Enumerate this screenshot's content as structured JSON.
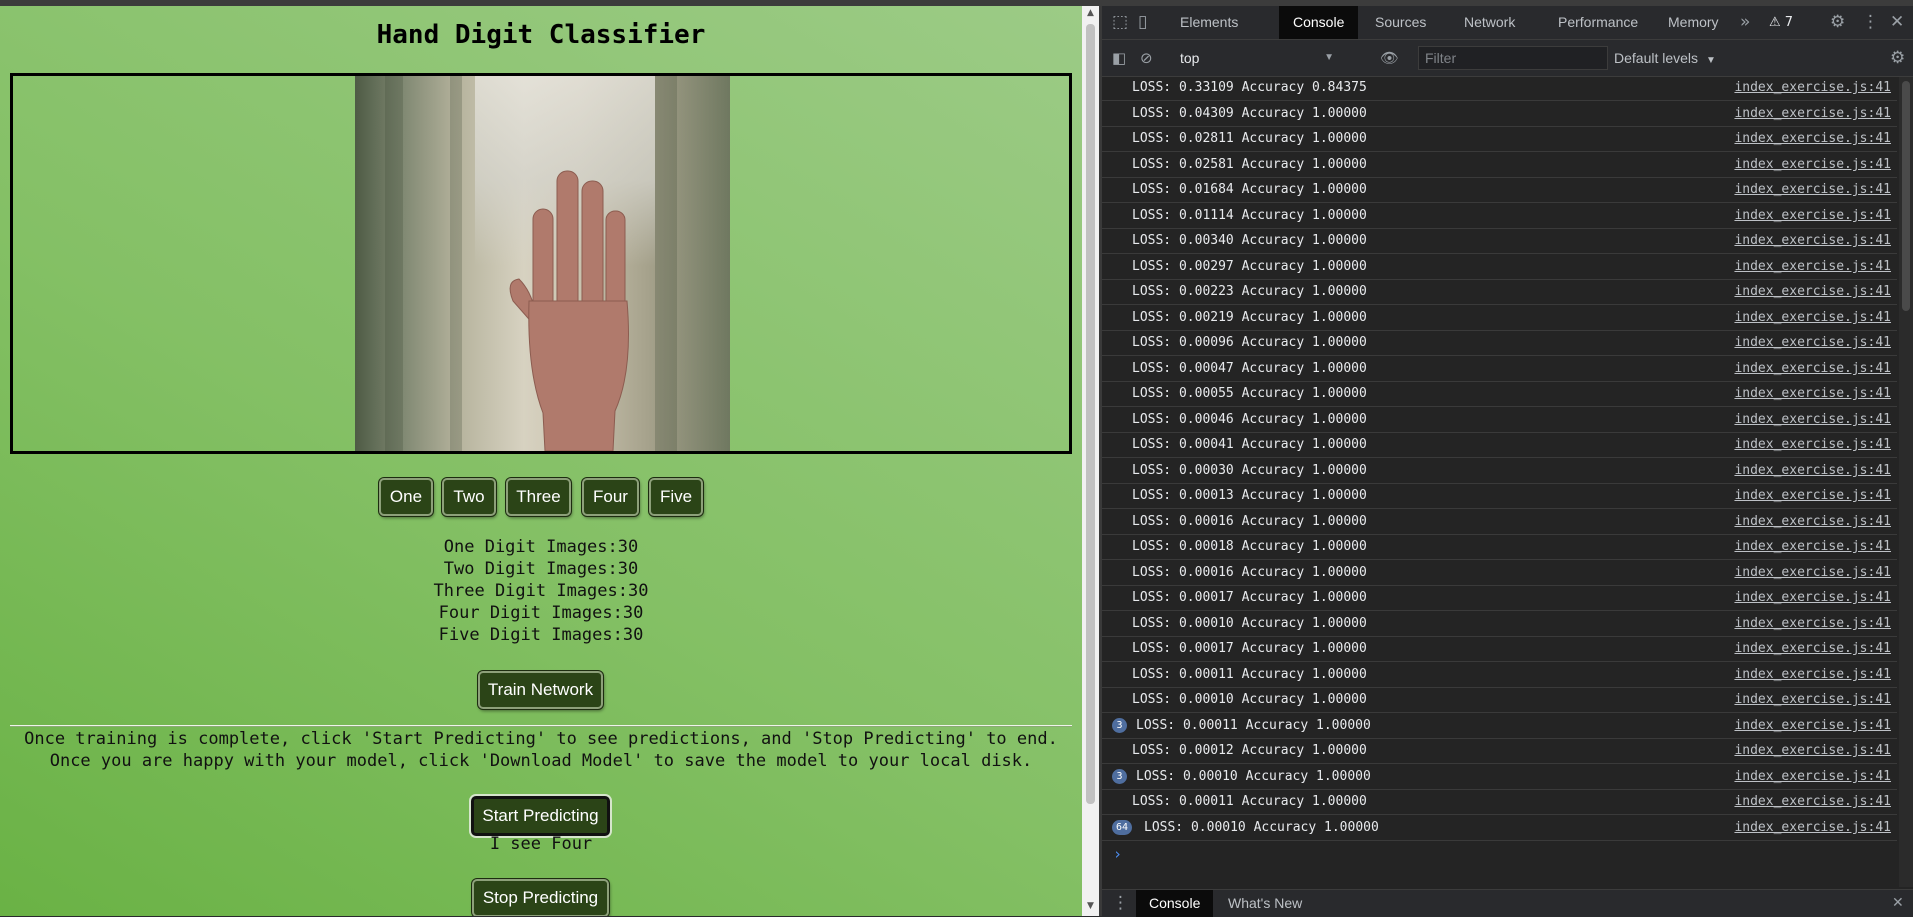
{
  "page": {
    "title": "Hand Digit Classifier",
    "digit_buttons": [
      "One",
      "Two",
      "Three",
      "Four",
      "Five"
    ],
    "counts": [
      "One Digit Images:30",
      "Two Digit Images:30",
      "Three Digit Images:30",
      "Four Digit Images:30",
      "Five Digit Images:30"
    ],
    "train_label": "Train Network",
    "instructions": [
      "Once training is complete, click 'Start Predicting' to see predictions, and 'Stop Predicting' to end.",
      "Once you are happy with your model, click 'Download Model' to save the model to your local disk."
    ],
    "start_label": "Start Predicting",
    "prediction": "I see Four",
    "stop_label": "Stop Predicting"
  },
  "devtools": {
    "tabs": [
      "Elements",
      "Console",
      "Sources",
      "Network",
      "Performance",
      "Memory"
    ],
    "selected_tab": "Console",
    "more_tabs": "»",
    "warnings": "⚠ 7",
    "context": "top",
    "filter_placeholder": "Filter",
    "levels": "Default levels",
    "log_source": "index_exercise.js:41",
    "logs": [
      {
        "msg": "LOSS: 0.33109 Accuracy 0.84375"
      },
      {
        "msg": "LOSS: 0.04309 Accuracy 1.00000"
      },
      {
        "msg": "LOSS: 0.02811 Accuracy 1.00000"
      },
      {
        "msg": "LOSS: 0.02581 Accuracy 1.00000"
      },
      {
        "msg": "LOSS: 0.01684 Accuracy 1.00000"
      },
      {
        "msg": "LOSS: 0.01114 Accuracy 1.00000"
      },
      {
        "msg": "LOSS: 0.00340 Accuracy 1.00000"
      },
      {
        "msg": "LOSS: 0.00297 Accuracy 1.00000"
      },
      {
        "msg": "LOSS: 0.00223 Accuracy 1.00000"
      },
      {
        "msg": "LOSS: 0.00219 Accuracy 1.00000"
      },
      {
        "msg": "LOSS: 0.00096 Accuracy 1.00000"
      },
      {
        "msg": "LOSS: 0.00047 Accuracy 1.00000"
      },
      {
        "msg": "LOSS: 0.00055 Accuracy 1.00000"
      },
      {
        "msg": "LOSS: 0.00046 Accuracy 1.00000"
      },
      {
        "msg": "LOSS: 0.00041 Accuracy 1.00000"
      },
      {
        "msg": "LOSS: 0.00030 Accuracy 1.00000"
      },
      {
        "msg": "LOSS: 0.00013 Accuracy 1.00000"
      },
      {
        "msg": "LOSS: 0.00016 Accuracy 1.00000"
      },
      {
        "msg": "LOSS: 0.00018 Accuracy 1.00000"
      },
      {
        "msg": "LOSS: 0.00016 Accuracy 1.00000"
      },
      {
        "msg": "LOSS: 0.00017 Accuracy 1.00000"
      },
      {
        "msg": "LOSS: 0.00010 Accuracy 1.00000"
      },
      {
        "msg": "LOSS: 0.00017 Accuracy 1.00000"
      },
      {
        "msg": "LOSS: 0.00011 Accuracy 1.00000"
      },
      {
        "msg": "LOSS: 0.00010 Accuracy 1.00000"
      },
      {
        "msg": "LOSS: 0.00011 Accuracy 1.00000",
        "count": "3"
      },
      {
        "msg": "LOSS: 0.00012 Accuracy 1.00000"
      },
      {
        "msg": "LOSS: 0.00010 Accuracy 1.00000",
        "count": "3"
      },
      {
        "msg": "LOSS: 0.00011 Accuracy 1.00000"
      },
      {
        "msg": "LOSS: 0.00010 Accuracy 1.00000",
        "count": "64"
      }
    ],
    "drawer_tabs": [
      "Console",
      "What's New"
    ]
  },
  "colors": {
    "button_bg": "#2b4417",
    "page_green": "#84c065",
    "badge_blue": "#4f6e9f"
  }
}
